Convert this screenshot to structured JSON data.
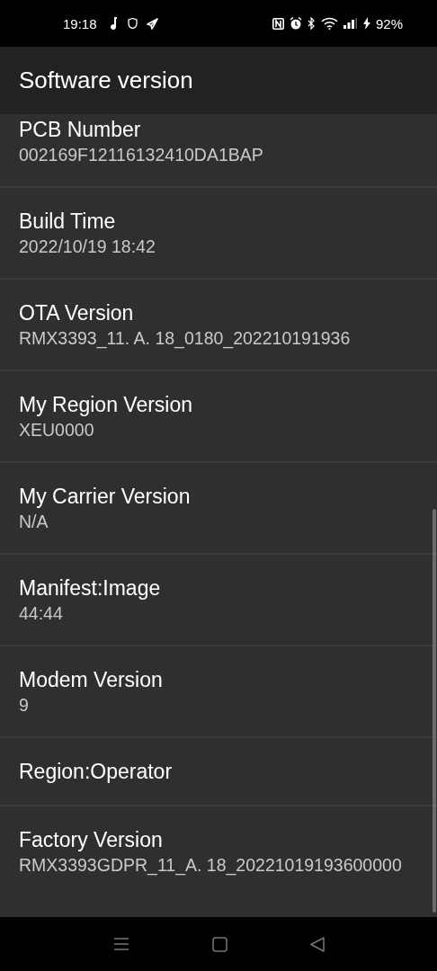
{
  "status_bar": {
    "time": "19:18",
    "battery": "92%"
  },
  "header": {
    "title": "Software version"
  },
  "items": [
    {
      "title": "PCB Number",
      "value": "002169F12116132410DA1BAP"
    },
    {
      "title": "Build Time",
      "value": "2022/10/19 18:42"
    },
    {
      "title": "OTA Version",
      "value": "RMX3393_11. A. 18_0180_202210191936"
    },
    {
      "title": "My Region Version",
      "value": "XEU0000"
    },
    {
      "title": "My Carrier Version",
      "value": "N/A"
    },
    {
      "title": "Manifest:Image",
      "value": "44:44"
    },
    {
      "title": "Modem Version",
      "value": "9"
    },
    {
      "title": "Region:Operator"
    },
    {
      "title": "Factory Version",
      "value": "RMX3393GDPR_11_A. 18_20221019193600000"
    }
  ]
}
